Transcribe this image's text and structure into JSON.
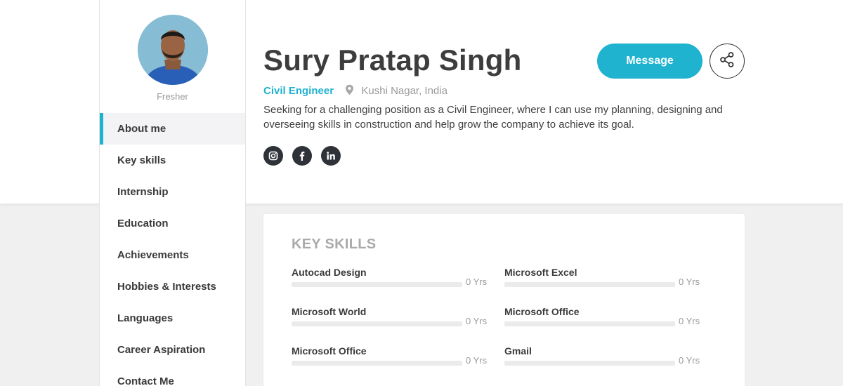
{
  "profile": {
    "name": "Sury Pratap Singh",
    "role": "Civil Engineer",
    "location": "Kushi Nagar, India",
    "status": "Fresher",
    "summary": "Seeking for a challenging position as a Civil Engineer, where I can use my planning, designing and overseeing skills in construction and help grow the company to achieve its goal."
  },
  "actions": {
    "message_label": "Message",
    "share_icon": "share-icon"
  },
  "socials": [
    {
      "icon": "instagram-icon"
    },
    {
      "icon": "facebook-icon"
    },
    {
      "icon": "linkedin-icon"
    }
  ],
  "sidebar": {
    "items": [
      {
        "label": "About me",
        "active": true
      },
      {
        "label": "Key skills"
      },
      {
        "label": "Internship"
      },
      {
        "label": "Education"
      },
      {
        "label": "Achievements"
      },
      {
        "label": "Hobbies & Interests"
      },
      {
        "label": "Languages"
      },
      {
        "label": "Career Aspiration"
      },
      {
        "label": "Contact Me"
      }
    ]
  },
  "key_skills": {
    "title": "KEY SKILLS",
    "items": [
      {
        "name": "Autocad Design",
        "years": "0 Yrs",
        "level": 0
      },
      {
        "name": "Microsoft Excel",
        "years": "0 Yrs",
        "level": 0
      },
      {
        "name": "Microsoft World",
        "years": "0 Yrs",
        "level": 0
      },
      {
        "name": "Microsoft Office",
        "years": "0 Yrs",
        "level": 0
      },
      {
        "name": "Microsoft Office",
        "years": "0 Yrs",
        "level": 0
      },
      {
        "name": "Gmail",
        "years": "0 Yrs",
        "level": 0
      }
    ]
  },
  "colors": {
    "accent": "#1fb3cf",
    "text_dark": "#3d3d3d",
    "text_muted": "#9a9a9a",
    "social_bg": "#2f3238"
  }
}
